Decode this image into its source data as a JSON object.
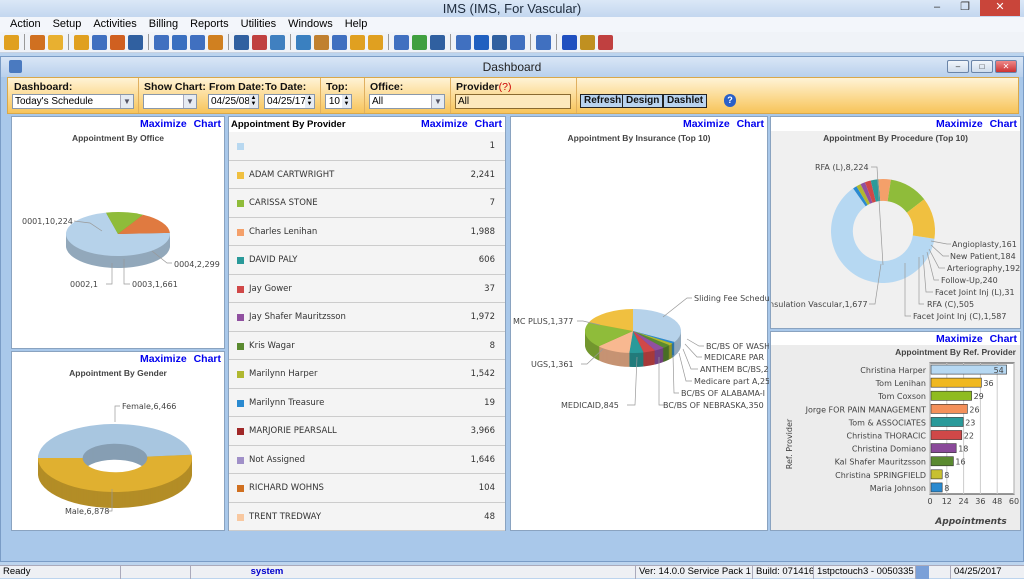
{
  "app": {
    "title": "IMS (IMS, For Vascular)"
  },
  "menu": [
    "Action",
    "Setup",
    "Activities",
    "Billing",
    "Reports",
    "Utilities",
    "Windows",
    "Help"
  ],
  "toolbar_icons": [
    "user-icon",
    "users-icon",
    "folder-icon",
    "folder-open-icon",
    "document-icon",
    "flask-icon",
    "shield-icon",
    "chart-icon",
    "calendar-icon",
    "gear-icon",
    "people-icon",
    "network-icon",
    "card-icon",
    "edit-icon",
    "lab-icon",
    "box-icon",
    "mail-icon",
    "inbox-icon",
    "folder-icon",
    "copy-icon",
    "bar-chart-icon",
    "report-icon",
    "documents-icon",
    "transfer-icon",
    "refresh-icon",
    "checklist-icon",
    "notepad-icon",
    "help-icon",
    "lock-icon",
    "exit-icon"
  ],
  "dashboard": {
    "title": "Dashboard",
    "filters": {
      "dashboard_label": "Dashboard:",
      "dashboard_value": "Today's Schedule",
      "show_chart_label": "Show Chart:",
      "show_chart_value": "",
      "from_date_label": "From Date:",
      "from_date": "04/25/08",
      "to_date_label": "To Date:",
      "to_date": "04/25/17",
      "top_label": "Top:",
      "top_value": "10",
      "office_label": "Office:",
      "office_value": "All",
      "provider_label": "Provider",
      "provider_hint": "(?)",
      "provider_value": "All"
    },
    "buttons": {
      "refresh": "Refresh",
      "design": "Design",
      "dashlet": "Dashlet"
    },
    "maximize": "Maximize  Chart"
  },
  "provider_list": {
    "title": "Appointment By Provider",
    "rows": [
      {
        "name": "",
        "value": "1",
        "color": "#b8d8f0"
      },
      {
        "name": "ADAM CARTWRIGHT",
        "value": "2,241",
        "color": "#f0c040"
      },
      {
        "name": "CARISSA STONE",
        "value": "7",
        "color": "#8fbc3a"
      },
      {
        "name": "Charles Lenihan",
        "value": "1,988",
        "color": "#f4a06a"
      },
      {
        "name": "DAVID PALY",
        "value": "606",
        "color": "#2a9a9a"
      },
      {
        "name": "Jay Gower",
        "value": "37",
        "color": "#d04848"
      },
      {
        "name": "Jay Shafer Mauritzsson",
        "value": "1,972",
        "color": "#9050a0"
      },
      {
        "name": "Kris Wagar",
        "value": "8",
        "color": "#5a8a30"
      },
      {
        "name": "Marilynn Harper",
        "value": "1,542",
        "color": "#b0b830"
      },
      {
        "name": "Marilynn Treasure",
        "value": "19",
        "color": "#2a8ad0"
      },
      {
        "name": "MARJORIE PEARSALL",
        "value": "3,966",
        "color": "#a02828"
      },
      {
        "name": "Not Assigned",
        "value": "1,646",
        "color": "#a090c8"
      },
      {
        "name": "RICHARD WOHNS",
        "value": "104",
        "color": "#d07020"
      },
      {
        "name": "TRENT TREDWAY",
        "value": "48",
        "color": "#f8c8a0"
      }
    ]
  },
  "chart_data": [
    {
      "type": "pie",
      "title": "Appointment By Office",
      "labels": [
        "0001,10,224",
        "0002,1",
        "0003,1,661",
        "0004,2,299"
      ],
      "values": [
        10224,
        1,
        1661,
        2299
      ],
      "colors": [
        "#b6d2ea",
        "#5a8a30",
        "#8fbc3a",
        "#e07a40"
      ]
    },
    {
      "type": "pie",
      "title": "Appointment By Gender",
      "labels": [
        "Female,6,466",
        "Male,6,878"
      ],
      "values": [
        6466,
        6878
      ],
      "colors": [
        "#a8c6e0",
        "#e0b030"
      ],
      "donut": true
    },
    {
      "type": "pie",
      "title": "Appointment By Insurance (Top 10)",
      "labels": [
        "Sliding Fee Schedul",
        "BC/BS OF WASH",
        "MEDICARE PAR",
        "ANTHEM BC/BS,2",
        "Medicare part A,25",
        "BC/BS OF ALABAMA-I",
        "BC/BS OF NEBRASKA,350",
        "MEDICAID,845",
        "UGS,1,361",
        "MC PLUS,1,377"
      ],
      "values": [
        2450,
        90,
        120,
        200,
        253,
        300,
        350,
        845,
        1361,
        1377
      ],
      "colors": [
        "#b6d2ea",
        "#2a8ad0",
        "#b0b830",
        "#5a8a30",
        "#9050a0",
        "#d04848",
        "#2a9a9a",
        "#f8b890",
        "#8fbc3a",
        "#f0c040"
      ]
    },
    {
      "type": "pie",
      "title": "Appointment By Procedure (Top 10)",
      "labels": [
        "RFA (L),8,224",
        "Angioplasty,161",
        "New Patient,184",
        "Arteriography,192",
        "Follow-Up,240",
        "Facet Joint Inj (L),31",
        "RFA (C),505",
        "Facet Joint Inj (C),1,587",
        "nsulation Vascular,1,677"
      ],
      "values": [
        8224,
        161,
        184,
        192,
        240,
        310,
        505,
        1587,
        1677
      ],
      "colors": [
        "#b6d8f2",
        "#2a8ad0",
        "#b0b830",
        "#9050a0",
        "#d04848",
        "#2a9a9a",
        "#f4a06a",
        "#8fbc3a",
        "#f0c040"
      ],
      "donut": true
    },
    {
      "type": "bar",
      "orientation": "horizontal",
      "title": "Appointment By Ref. Provider",
      "ylabel": "Ref. Provider",
      "xlabel": "Appointments",
      "xlim": [
        0,
        60
      ],
      "ticks": [
        "0",
        "12",
        "24",
        "36",
        "48",
        "60"
      ],
      "categories": [
        "Christina Harper",
        "Tom Lenihan",
        "Tom Coxson",
        "Jorge FOR PAIN MANAGEMENT",
        "Tom & ASSOCIATES",
        "Christina THORACIC",
        "Christina Domiano",
        "Kal Shafer Mauritzsson",
        "Christina SPRINGFIELD",
        "Maria Johnson"
      ],
      "values": [
        54,
        36,
        29,
        26,
        23,
        22,
        18,
        16,
        8,
        8
      ],
      "colors": [
        "#b6d8f2",
        "#f0b820",
        "#8fbc20",
        "#f4905a",
        "#2a9a9a",
        "#d04848",
        "#8a4a9a",
        "#5a8a30",
        "#c8c030",
        "#2a8ad0"
      ]
    }
  ],
  "status": {
    "ready": "Ready",
    "user": "system",
    "version": "Ver: 14.0.0 Service Pack 1",
    "build": "Build: 071416",
    "station": "1stpctouch3 - 0050335",
    "date": "04/25/2017"
  }
}
